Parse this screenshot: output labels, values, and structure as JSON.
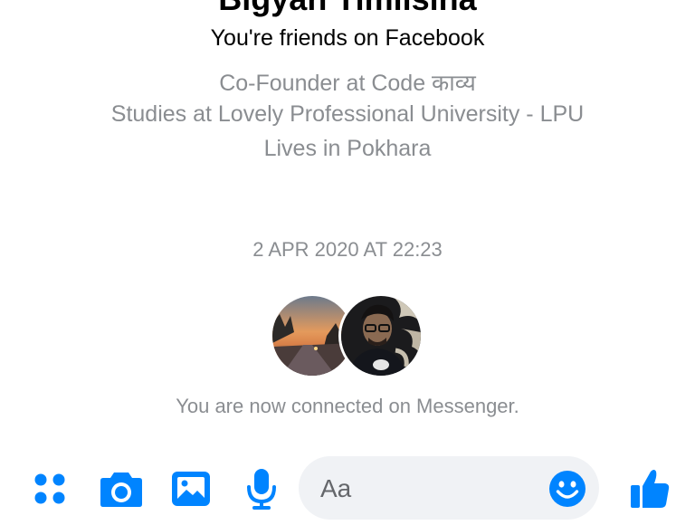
{
  "profile": {
    "name": "Bigyan Timilsina",
    "friends_status": "You're friends on Facebook",
    "work": "Co-Founder at Code काव्य",
    "education": "Studies at Lovely Professional University - LPU",
    "location": "Lives in Pokhara"
  },
  "conversation": {
    "timestamp": "2 APR 2020 AT 22:23",
    "connected_message": "You are now connected on Messenger."
  },
  "composer": {
    "placeholder": "Aa"
  },
  "toolbar": {
    "icons": [
      "apps-icon",
      "camera-icon",
      "gallery-icon",
      "microphone-icon",
      "emoji-icon",
      "thumbs-up-icon"
    ]
  },
  "colors": {
    "accent": "#0084ff",
    "muted_text": "#8a8d91",
    "composer_bg": "#f0f2f5"
  }
}
